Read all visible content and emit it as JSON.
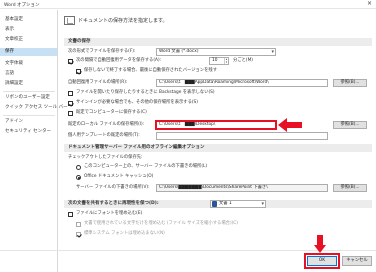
{
  "window": {
    "title": "Word オプション",
    "close": "×"
  },
  "sidebar": {
    "items": [
      {
        "label": "基本設定"
      },
      {
        "label": "表示"
      },
      {
        "label": "文章校正"
      },
      {
        "label": "保存"
      },
      {
        "label": "文字体裁"
      },
      {
        "label": "言語"
      },
      {
        "label": "詳細設定"
      },
      {
        "label": "リボンのユーザー設定"
      },
      {
        "label": "クイック アクセス ツール バー"
      },
      {
        "label": "アドイン"
      },
      {
        "label": "セキュリティ センター"
      }
    ]
  },
  "header": {
    "text": "ドキュメントの保存方法を指定します。"
  },
  "save_section": {
    "title": "文書の保存",
    "format_label": "次の形式でファイルを保存する(F):",
    "format_value": "Word 文書 (*.docx)",
    "autorecover_label": "次の間隔で自動回復用データを保存する(A):",
    "autorecover_minutes": "10",
    "minutes_unit": "分ごと(M)",
    "keep_last_label": "保存しないで終了する場合、最後に自動保存されたバージョンを残す",
    "autorecover_path_label": "自動回復用ファイルの場所(R):",
    "autorecover_path": "C:\\Users\\ｴ　███AppData\\Roaming\\Microsoft\\Word\\",
    "browse_label": "参照(B)...",
    "backstage_open_label": "ファイルを開いたり保存したりするときに Backstage を表示しない(S)",
    "show_other_label": "サインインが必要な場合でも、その他の保存場所を表示する(S)",
    "default_computer_label": "既定でコンピューターに保存する(C)",
    "default_local_label": "既定のローカル ファイルの保存場所(I):",
    "default_local_path": "C:\\Users\\ｴ　███\\Desktop\\",
    "browse2_label": "参照(B)...",
    "template_label": "個人用テンプレートの既定の場所(T):",
    "template_path": ""
  },
  "offline_section": {
    "title": "ドキュメント管理サーバー ファイル用のオフライン編集オプション",
    "checkout_label": "チェックアウトしたファイルの保存先:",
    "option1": "このコンピューター上の、サーバー ファイルの下書きの場所(L)",
    "option2": "Office ドキュメント キャッシュ(O)",
    "drafts_label": "サーバー ファイルの下書きの場所(V):",
    "drafts_path": "C:\\Users\\███████\\Documents\\SharePoint 下書き\\",
    "browse3_label": "参照(B)..."
  },
  "fidelity_section": {
    "title": "次の文書を共有するときに再現性を保つ(D):",
    "doc_value": "文書 1",
    "embed_fonts_label": "ファイルにフォントを埋め込む(E)",
    "embed_only_used_label": "文書で使用されている文字だけを埋め込む (ファイル サイズを縮小する場合)(C)",
    "no_common_label": "標準システム フォントは埋め込まない(N)"
  },
  "footer": {
    "ok": "OK",
    "cancel": "キャンセル"
  },
  "colors": {
    "accent": "#0078d7",
    "highlight_red": "#e81123",
    "nav_active": "#c7e0f4"
  }
}
